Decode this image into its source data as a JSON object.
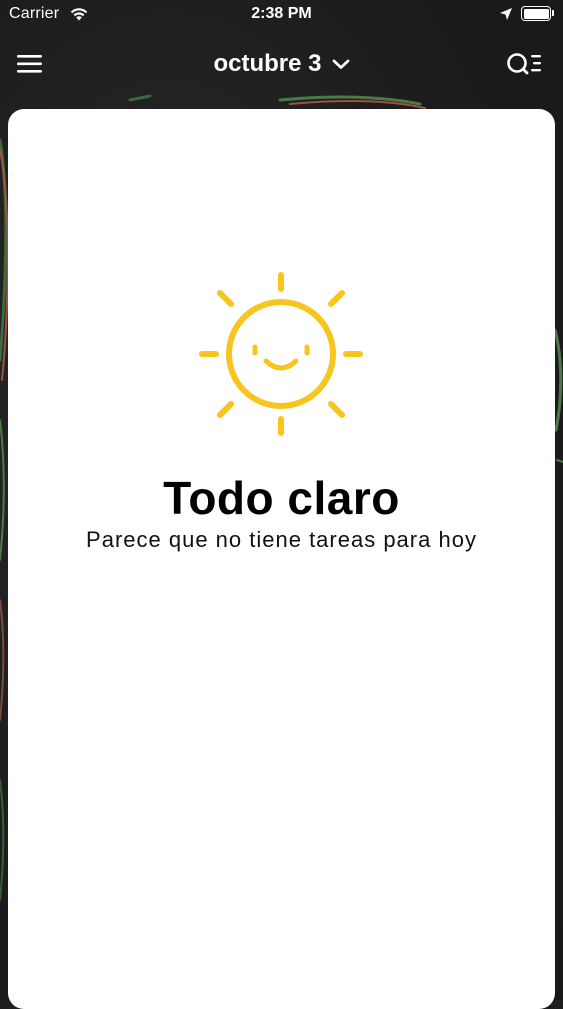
{
  "status_bar": {
    "carrier": "Carrier",
    "time": "2:38 PM"
  },
  "nav": {
    "date_label": "octubre 3"
  },
  "empty_state": {
    "title": "Todo claro",
    "subtitle": "Parece que no tiene tareas para hoy"
  },
  "colors": {
    "accent_sun": "#F7C51E",
    "card_bg": "#FFFFFF",
    "header_bg": "#1F1F1F"
  },
  "icons": {
    "menu": "hamburger-icon",
    "date_dropdown": "chevron-down-icon",
    "search_list": "search-list-icon",
    "empty": "smiling-sun-icon"
  }
}
